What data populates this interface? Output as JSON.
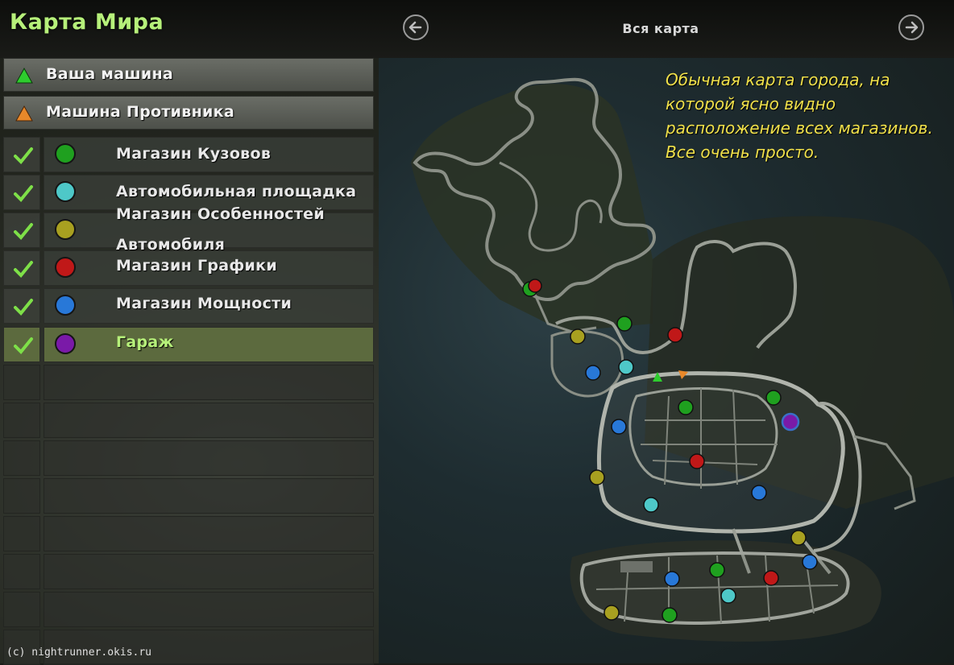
{
  "header": {
    "title": "Карта Мира",
    "view_label": "Вся карта"
  },
  "legend": {
    "player_car": {
      "label": "Ваша машина",
      "color": "#2ecc2e",
      "icon": "green-triangle-icon"
    },
    "enemy_car": {
      "label": "Машина Противника",
      "color": "#e8882a",
      "icon": "orange-triangle-icon"
    },
    "items": [
      {
        "label_lines": [
          "Магазин Кузовов"
        ],
        "color": "#1fa01f",
        "checked": true
      },
      {
        "label_lines": [
          "Автомобильная площадка"
        ],
        "color": "#4ec8c8",
        "checked": true
      },
      {
        "label_lines": [
          "Магазин Особенностей",
          "Автомобиля"
        ],
        "color": "#a8a020",
        "checked": true
      },
      {
        "label_lines": [
          "Магазин Графики"
        ],
        "color": "#c01818",
        "checked": true
      },
      {
        "label_lines": [
          "Магазин Мощности"
        ],
        "color": "#2878d8",
        "checked": true
      },
      {
        "label_lines": [
          "Гараж"
        ],
        "color": "#7a1aa8",
        "checked": true,
        "selected": true
      }
    ]
  },
  "map": {
    "caption_lines": [
      "Обычная карта города, на",
      "которой ясно видно",
      "расположение всех магазинов.",
      "Все очень просто."
    ]
  },
  "credit": "(c) nightrunner.okis.ru",
  "colors": {
    "title": "#b6f07a",
    "caption": "#f0e04a",
    "selected_row": "#5c6a3e",
    "checkmark": "#7ee048"
  }
}
